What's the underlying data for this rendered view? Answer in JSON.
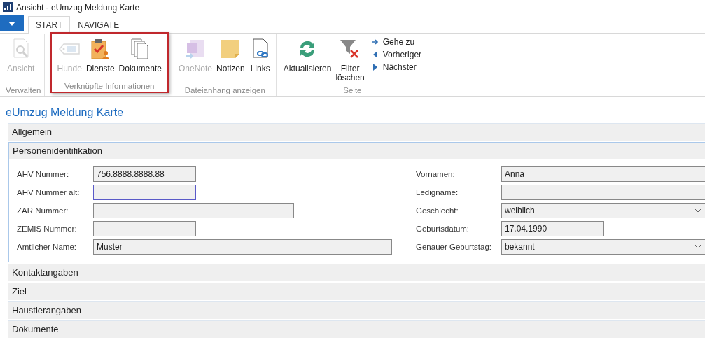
{
  "window": {
    "title": "Ansicht - eUmzug Meldung Karte"
  },
  "tabs": [
    {
      "label": "START",
      "selected": true
    },
    {
      "label": "NAVIGATE",
      "selected": false
    }
  ],
  "ribbon": {
    "groups": [
      {
        "label": "Verwalten",
        "highlighted": false,
        "buttons": [
          {
            "label": "Ansicht",
            "disabled": true
          }
        ]
      },
      {
        "label": "Verknüpfte Informationen",
        "highlighted": true,
        "buttons": [
          {
            "label": "Hunde",
            "disabled": true
          },
          {
            "label": "Dienste",
            "disabled": false
          },
          {
            "label": "Dokumente",
            "disabled": false
          }
        ]
      },
      {
        "label": "Dateianhang anzeigen",
        "highlighted": false,
        "buttons": [
          {
            "label": "OneNote",
            "disabled": true
          },
          {
            "label": "Notizen",
            "disabled": false
          },
          {
            "label": "Links",
            "disabled": false
          }
        ]
      },
      {
        "label": "Seite",
        "highlighted": false,
        "buttons": [
          {
            "label": "Aktualisieren",
            "disabled": false
          },
          {
            "label": "Filter löschen",
            "disabled": false
          }
        ],
        "small_buttons": [
          {
            "label": "Gehe zu"
          },
          {
            "label": "Vorheriger"
          },
          {
            "label": "Nächster"
          }
        ]
      }
    ]
  },
  "page_title": "eUmzug Meldung Karte",
  "sections": [
    {
      "title": "Allgemein",
      "expanded": false
    },
    {
      "title": "Personenidentifikation",
      "expanded": true,
      "left_fields": [
        {
          "label": "AHV Nummer:",
          "kind": "text",
          "value": "756.8888.8888.88",
          "focused": false
        },
        {
          "label": "AHV Nummer alt:",
          "kind": "text",
          "focused": true
        },
        {
          "label": "ZAR Nummer:",
          "kind": "text",
          "focused": false
        },
        {
          "label": "ZEMIS Nummer:",
          "kind": "text",
          "focused": false
        },
        {
          "label": "Amtlicher Name:",
          "kind": "text",
          "value": "Muster",
          "focused": false
        }
      ],
      "right_fields": [
        {
          "label": "Vornamen:",
          "kind": "text",
          "value": "Anna",
          "focused": false
        },
        {
          "label": "Ledigname:",
          "kind": "text",
          "focused": false
        },
        {
          "label": "Geschlecht:",
          "kind": "dropdown",
          "value": "weiblich",
          "focused": false
        },
        {
          "label": "Geburtsdatum:",
          "kind": "text",
          "value": "17.04.1990",
          "focused": false
        },
        {
          "label": "Genauer Geburtstag:",
          "kind": "dropdown",
          "value": "bekannt",
          "focused": false
        }
      ]
    },
    {
      "title": "Kontaktangaben",
      "expanded": false
    },
    {
      "title": "Ziel",
      "expanded": false
    },
    {
      "title": "Haustierangaben",
      "expanded": false
    },
    {
      "title": "Dokumente",
      "expanded": false
    }
  ]
}
